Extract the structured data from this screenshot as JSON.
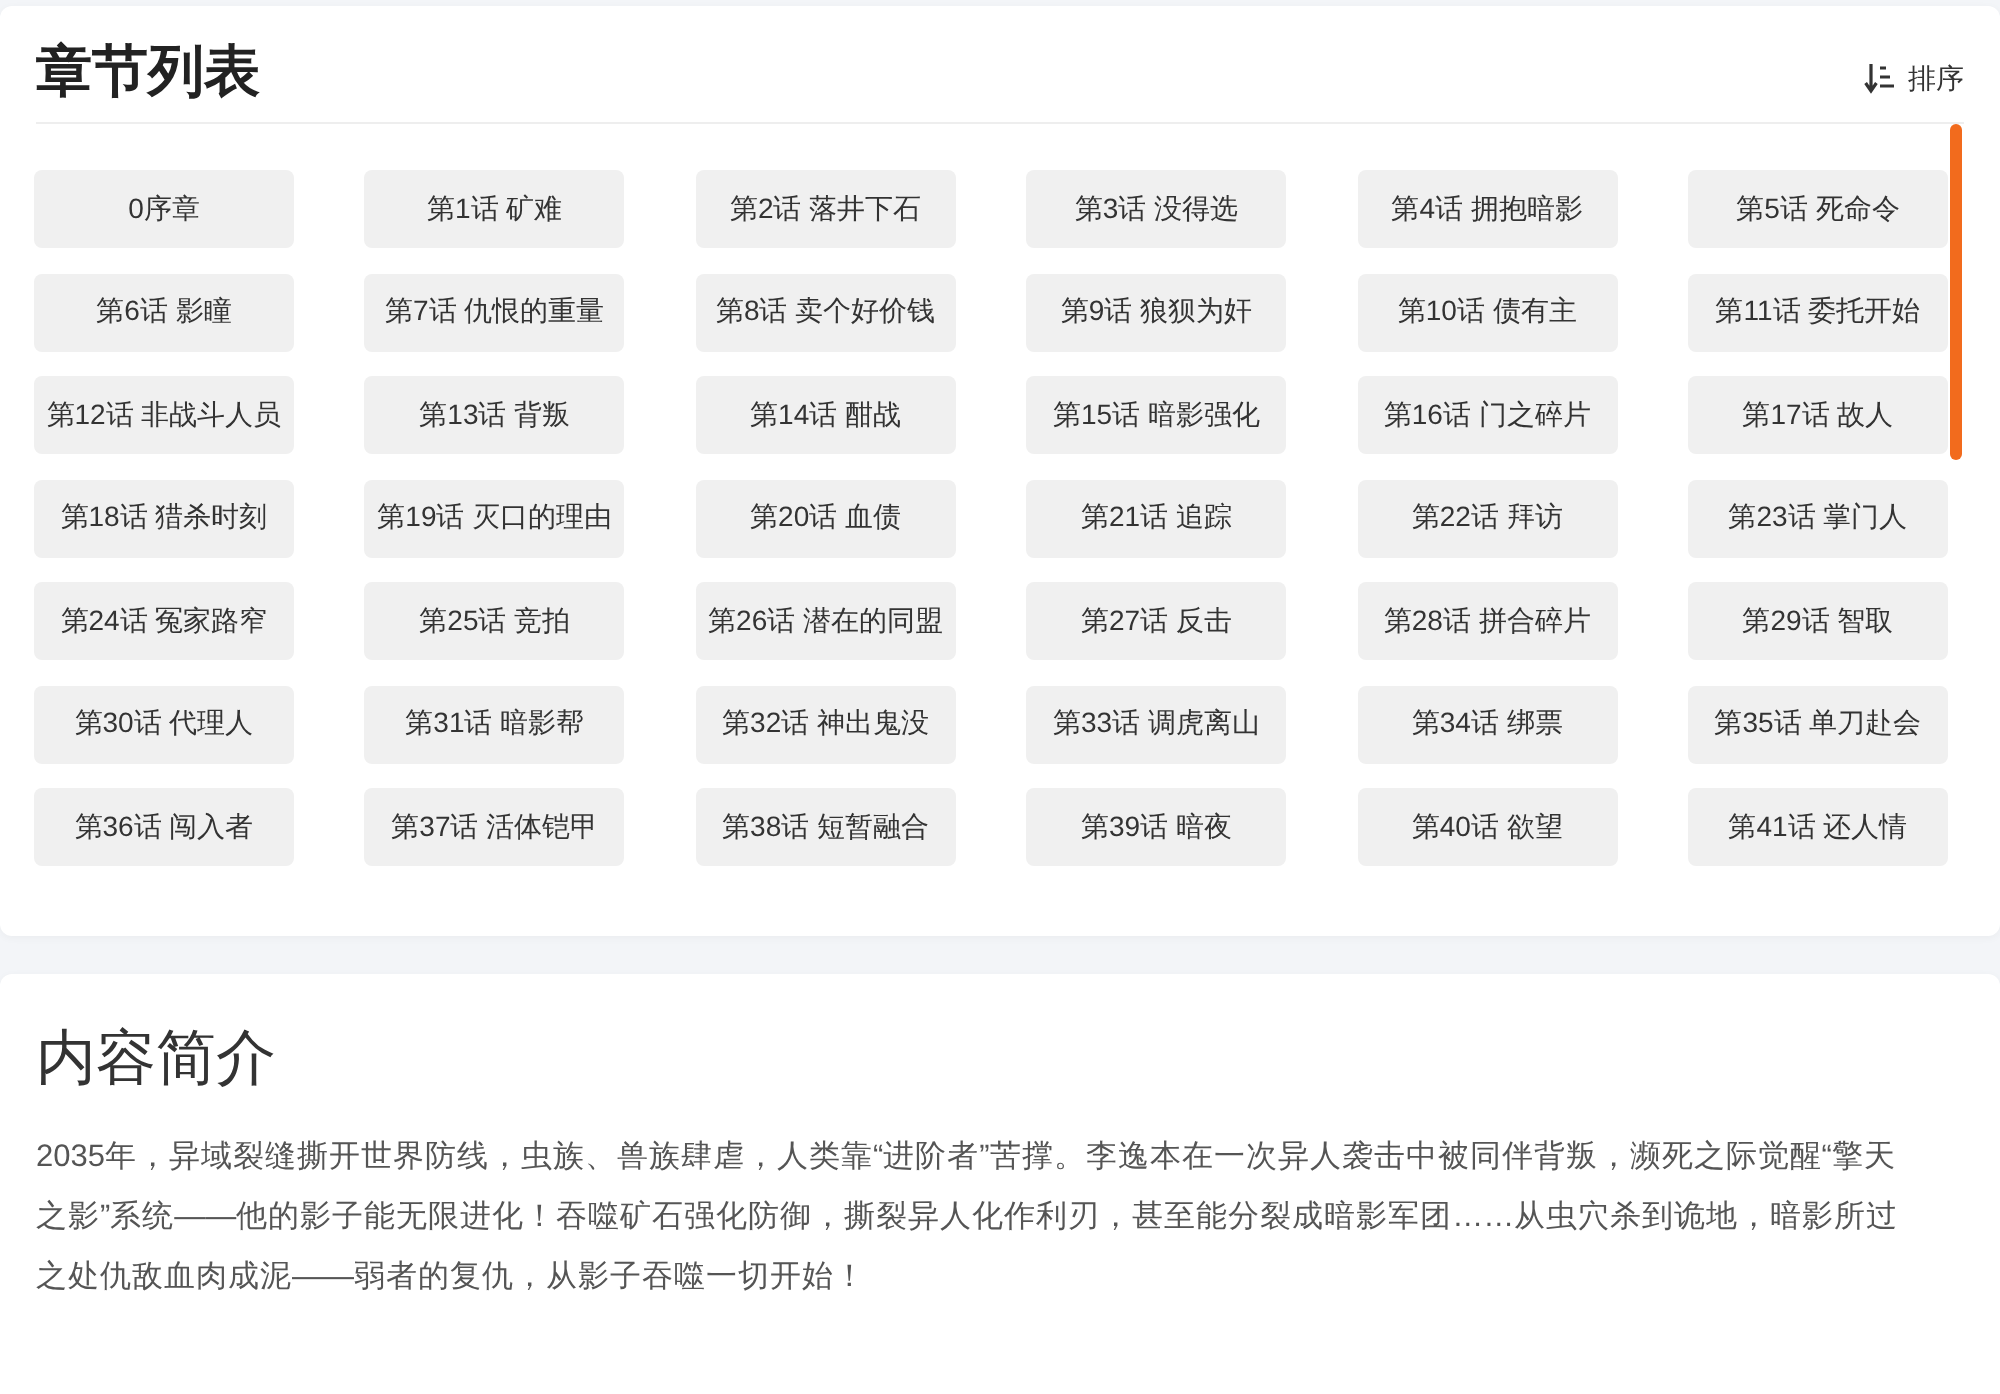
{
  "chapter_list": {
    "title": "章节列表",
    "sort_button": {
      "label": "排序"
    },
    "chapters": [
      "0序章",
      "第1话 矿难",
      "第2话 落井下石",
      "第3话 没得选",
      "第4话 拥抱暗影",
      "第5话 死命令",
      "第6话 影瞳",
      "第7话 仇恨的重量",
      "第8话 卖个好价钱",
      "第9话 狼狈为奸",
      "第10话 债有主",
      "第11话 委托开始",
      "第12话 非战斗人员",
      "第13话 背叛",
      "第14话 酣战",
      "第15话 暗影强化",
      "第16话 门之碎片",
      "第17话 故人",
      "第18话 猎杀时刻",
      "第19话 灭口的理由",
      "第20话 血债",
      "第21话 追踪",
      "第22话 拜访",
      "第23话 掌门人",
      "第24话 冤家路窄",
      "第25话 竞拍",
      "第26话 潜在的同盟",
      "第27话 反击",
      "第28话 拼合碎片",
      "第29话 智取",
      "第30话 代理人",
      "第31话 暗影帮",
      "第32话 神出鬼没",
      "第33话 调虎离山",
      "第34话 绑票",
      "第35话 单刀赴会",
      "第36话 闯入者",
      "第37话 活体铠甲",
      "第38话 短暂融合",
      "第39话 暗夜",
      "第40话 欲望",
      "第41话 还人情"
    ]
  },
  "synopsis": {
    "title": "内容简介",
    "text": "2035年，异域裂缝撕开世界防线，虫族、兽族肆虐，人类靠“进阶者”苦撑。李逸本在一次异人袭击中被同伴背叛，濒死之际觉醒“擎天之影”系统——他的影子能无限进化！吞噬矿石强化防御，撕裂异人化作利刃，甚至能分裂成暗影军团……从虫穴杀到诡地，暗影所过之处仇敌血肉成泥——弱者的复仇，从影子吞噬一切开始！"
  }
}
